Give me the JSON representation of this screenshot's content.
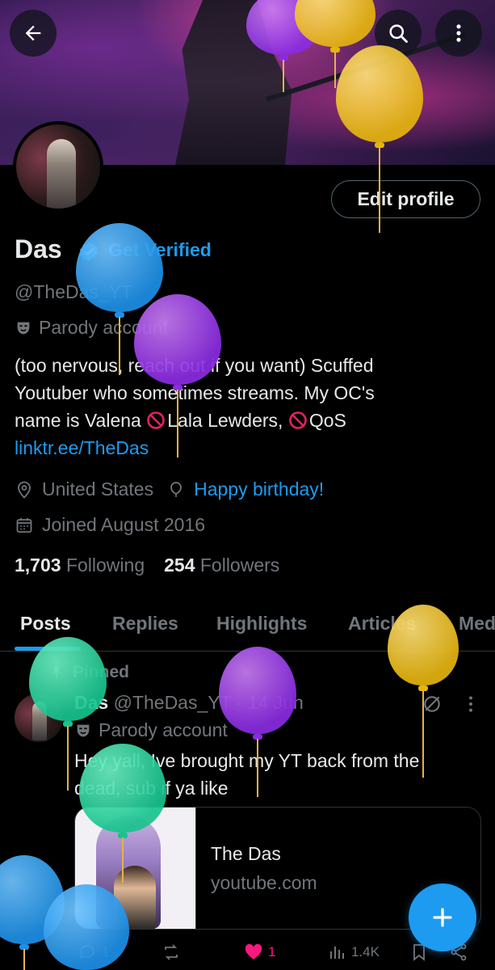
{
  "header": {
    "back_icon": "arrow-left-icon",
    "search_icon": "search-icon",
    "more_icon": "more-vertical-icon"
  },
  "profile": {
    "edit_label": "Edit profile",
    "name": "Das",
    "get_verified": "Get Verified",
    "handle": "@TheDas_YT",
    "parody_label": "Parody account",
    "bio_line1": "(too nervous, reach out if you want)  Scuffed",
    "bio_line2": "Youtuber who sometimes streams. My OC's",
    "bio_line3a": "name is Valena ",
    "bio_line3b": "Lala Lewders, ",
    "bio_line3c": "QoS",
    "link": "linktr.ee/TheDas",
    "location": "United States",
    "birthday": "Happy birthday!",
    "joined": "Joined August 2016",
    "following_count": "1,703",
    "following_label": "Following",
    "followers_count": "254",
    "followers_label": "Followers"
  },
  "tabs": [
    {
      "label": "Posts"
    },
    {
      "label": "Replies"
    },
    {
      "label": "Highlights"
    },
    {
      "label": "Articles"
    },
    {
      "label": "Med"
    }
  ],
  "post": {
    "pinned_label": "Pinned",
    "author_name": "Das",
    "author_handle": "@TheDas_YT",
    "dot": "·",
    "date": "14 Jun",
    "parody_label": "Parody account",
    "text_line1": "Hey yall, Ive brought my YT back from the",
    "text_line2": "dead, sub if ya like",
    "card_title": "The Das",
    "card_domain": "youtube.com",
    "actions": {
      "replies": "1",
      "likes": "1",
      "views": "1.4K"
    }
  },
  "colors": {
    "accent": "#1d9bf0",
    "like": "#f91880",
    "muted": "#71767b",
    "text": "#e7e9ea",
    "border": "#2f3336"
  }
}
